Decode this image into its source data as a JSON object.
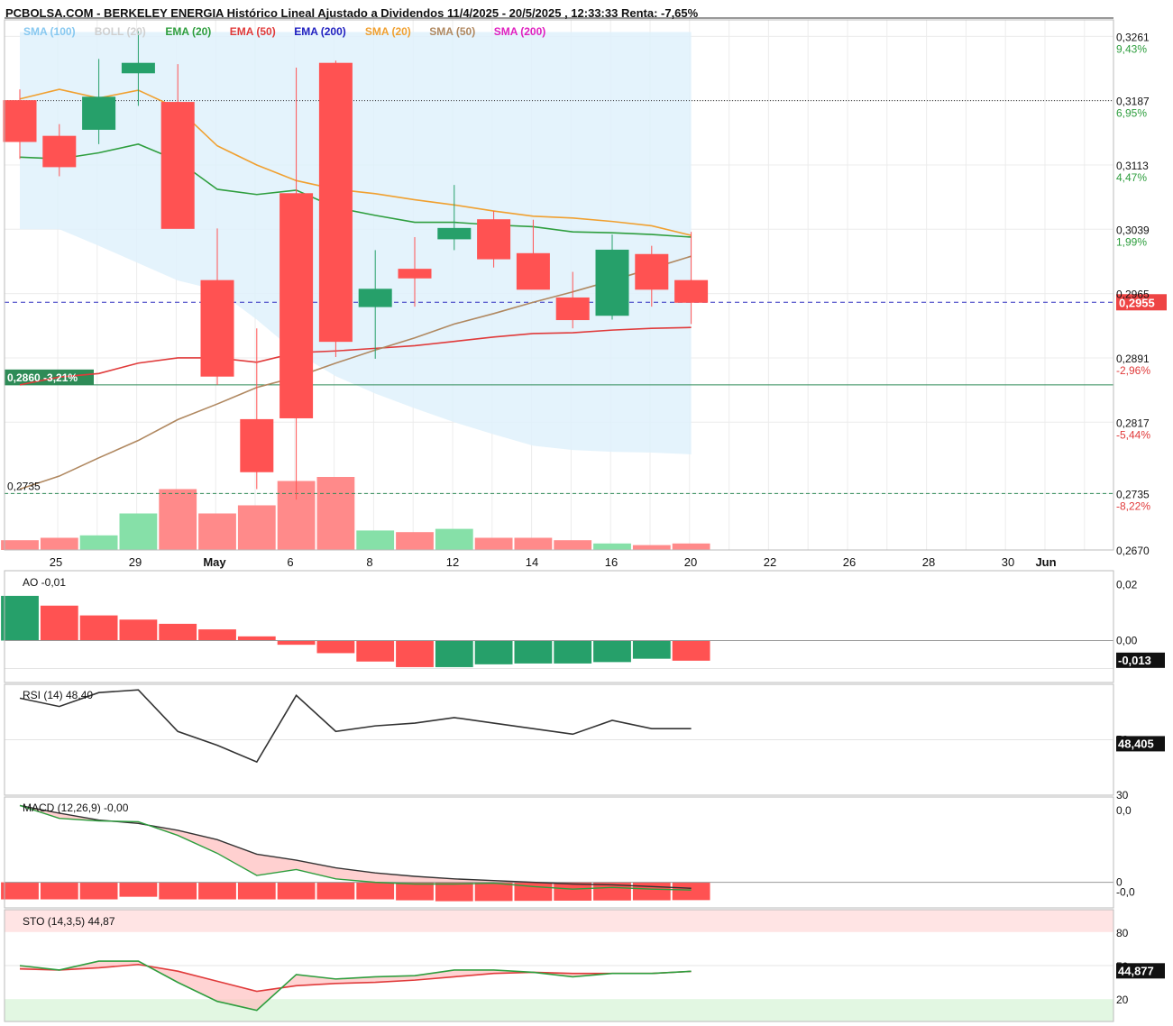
{
  "header": {
    "title": "PCBOLSA.COM - BERKELEY ENERGIA Histórico Lineal Ajustado a Dividendos 11/4/2025 - 20/5/2025 , 12:33:33 Renta: -7,65%"
  },
  "colors": {
    "up": "#26a06a",
    "down": "#ff5252",
    "sma100": "#87c8f0",
    "boll": "#c8c8c8",
    "ema20": "#2e9e3e",
    "ema50": "#e03a3a",
    "ema200": "#2020c0",
    "sma20": "#f0a030",
    "sma50": "#b08860",
    "sma200": "#e020c0",
    "band_fill": "#dff1fb",
    "last_price": "#ee4444",
    "ref_line": "#2e8b57"
  },
  "legend": [
    {
      "label": "SMA (100)",
      "color": "#87c8f0"
    },
    {
      "label": "BOLL (20)",
      "color": "#d0d0d0"
    },
    {
      "label": "EMA (20)",
      "color": "#2e9e3e"
    },
    {
      "label": "EMA (50)",
      "color": "#e03a3a"
    },
    {
      "label": "EMA (200)",
      "color": "#2020c0"
    },
    {
      "label": "SMA (20)",
      "color": "#f0a030"
    },
    {
      "label": "SMA (50)",
      "color": "#b08860"
    },
    {
      "label": "SMA (200)",
      "color": "#e020c0"
    }
  ],
  "price_axis": [
    {
      "value": "0,3261",
      "pct": "9,43%",
      "pct_color": "#2e9e3e"
    },
    {
      "value": "0,3187",
      "pct": "6,95%",
      "pct_color": "#2e9e3e"
    },
    {
      "value": "0,3113",
      "pct": "4,47%",
      "pct_color": "#2e9e3e"
    },
    {
      "value": "0,3039",
      "pct": "1,99%",
      "pct_color": "#2e9e3e"
    },
    {
      "value": "0,2965",
      "pct": "",
      "pct_color": "#2e9e3e"
    },
    {
      "value": "0,2891",
      "pct": "-2,96%",
      "pct_color": "#e03a3a"
    },
    {
      "value": "0,2817",
      "pct": "-5,44%",
      "pct_color": "#e03a3a"
    },
    {
      "value": "0,2735",
      "pct": "-8,22%",
      "pct_color": "#e03a3a"
    },
    {
      "value": "0,2670",
      "pct": "",
      "pct_color": "#e03a3a"
    }
  ],
  "last_price_label": "0,2955",
  "ref_label": "0,2860 -3,21%",
  "low_label": "0,2735",
  "x_ticks": [
    {
      "label": "25",
      "bold": false
    },
    {
      "label": "29",
      "bold": false
    },
    {
      "label": "May",
      "bold": true
    },
    {
      "label": "6",
      "bold": false
    },
    {
      "label": "8",
      "bold": false
    },
    {
      "label": "12",
      "bold": false
    },
    {
      "label": "14",
      "bold": false
    },
    {
      "label": "16",
      "bold": false
    },
    {
      "label": "20",
      "bold": false
    },
    {
      "label": "22",
      "bold": false
    },
    {
      "label": "26",
      "bold": false
    },
    {
      "label": "28",
      "bold": false
    },
    {
      "label": "30",
      "bold": false
    },
    {
      "label": "Jun",
      "bold": true
    }
  ],
  "chart_data": [
    {
      "type": "candlestick",
      "title": "PCBOLSA.COM - BERKELEY ENERGIA Histórico Lineal Ajustado a Dividendos 11/4/2025 - 20/5/2025 , 12:33:33 Renta: -7,65%",
      "ylim": [
        0.267,
        0.328
      ],
      "candles": [
        {
          "open": 0.3187,
          "high": 0.32,
          "low": 0.312,
          "close": 0.314
        },
        {
          "open": 0.3146,
          "high": 0.316,
          "low": 0.31,
          "close": 0.3111
        },
        {
          "open": 0.3154,
          "high": 0.3235,
          "low": 0.3137,
          "close": 0.3191
        },
        {
          "open": 0.3219,
          "high": 0.3267,
          "low": 0.3181,
          "close": 0.323
        },
        {
          "open": 0.3185,
          "high": 0.3229,
          "low": 0.3044,
          "close": 0.304
        },
        {
          "open": 0.298,
          "high": 0.304,
          "low": 0.286,
          "close": 0.287
        },
        {
          "open": 0.282,
          "high": 0.2925,
          "low": 0.274,
          "close": 0.276
        },
        {
          "open": 0.308,
          "high": 0.3225,
          "low": 0.2728,
          "close": 0.2822
        },
        {
          "open": 0.323,
          "high": 0.3233,
          "low": 0.2892,
          "close": 0.291
        },
        {
          "open": 0.295,
          "high": 0.3015,
          "low": 0.289,
          "close": 0.297
        },
        {
          "open": 0.2993,
          "high": 0.303,
          "low": 0.295,
          "close": 0.2983
        },
        {
          "open": 0.3028,
          "high": 0.309,
          "low": 0.3015,
          "close": 0.304
        },
        {
          "open": 0.305,
          "high": 0.306,
          "low": 0.2995,
          "close": 0.3005
        },
        {
          "open": 0.3011,
          "high": 0.305,
          "low": 0.297,
          "close": 0.297
        },
        {
          "open": 0.296,
          "high": 0.299,
          "low": 0.2925,
          "close": 0.2935
        },
        {
          "open": 0.294,
          "high": 0.3033,
          "low": 0.2935,
          "close": 0.3015
        },
        {
          "open": 0.301,
          "high": 0.302,
          "low": 0.295,
          "close": 0.297
        },
        {
          "open": 0.298,
          "high": 0.3036,
          "low": 0.293,
          "close": 0.2955
        }
      ],
      "series": [
        {
          "name": "SMA (20)",
          "values": [
            0.3189,
            0.32,
            0.319,
            0.3199,
            0.3178,
            0.3135,
            0.3113,
            0.3095,
            0.3085,
            0.308,
            0.3073,
            0.3067,
            0.306,
            0.3054,
            0.3052,
            0.3048,
            0.3043,
            0.3032
          ]
        },
        {
          "name": "EMA (20)",
          "values": [
            0.3122,
            0.312,
            0.3127,
            0.3137,
            0.3118,
            0.3085,
            0.3079,
            0.3084,
            0.3064,
            0.3055,
            0.3047,
            0.3047,
            0.3044,
            0.3042,
            0.3036,
            0.3035,
            0.3033,
            0.303
          ]
        },
        {
          "name": "EMA (50)",
          "values": [
            0.286,
            0.2869,
            0.2873,
            0.2885,
            0.2891,
            0.2891,
            0.2886,
            0.2897,
            0.2899,
            0.2902,
            0.2905,
            0.291,
            0.2915,
            0.2919,
            0.292,
            0.2923,
            0.2925,
            0.2926
          ]
        },
        {
          "name": "SMA (50)",
          "values": [
            0.274,
            0.2755,
            0.2776,
            0.2796,
            0.282,
            0.2838,
            0.2857,
            0.2869,
            0.2885,
            0.29,
            0.2914,
            0.293,
            0.2942,
            0.2955,
            0.2967,
            0.298,
            0.2994,
            0.3008
          ]
        }
      ],
      "bollinger": {
        "upper": [
          0.3266,
          0.3266,
          0.3266,
          0.3266,
          0.3266,
          0.3266,
          0.3266,
          0.3266,
          0.3266,
          0.3266,
          0.3266,
          0.3266,
          0.3266,
          0.3266,
          0.3266,
          0.3266,
          0.3266,
          0.3266
        ],
        "lower": [
          0.3039,
          0.3039,
          0.302,
          0.3,
          0.298,
          0.2969,
          0.2935,
          0.2897,
          0.287,
          0.285,
          0.2833,
          0.2817,
          0.2803,
          0.279,
          0.2785,
          0.2783,
          0.2782,
          0.278
        ]
      },
      "volume": [
        12,
        15,
        18,
        45,
        75,
        45,
        55,
        85,
        90,
        24,
        22,
        26,
        15,
        15,
        12,
        8,
        6,
        8
      ],
      "last_price": 0.2955,
      "reference": 0.286,
      "low_line": 0.2735,
      "upper_line": 0.3187
    },
    {
      "type": "bar",
      "name": "AO",
      "title": "AO -0,01",
      "ylim": [
        -0.015,
        0.025
      ],
      "values": [
        0.016,
        0.0125,
        0.009,
        0.0075,
        0.006,
        0.004,
        0.0015,
        -0.0015,
        -0.0045,
        -0.0075,
        -0.0095,
        -0.0095,
        -0.0085,
        -0.0082,
        -0.0082,
        -0.0077,
        -0.0065,
        -0.0072
      ],
      "colors": [
        "up",
        "down",
        "down",
        "down",
        "down",
        "down",
        "down",
        "down",
        "down",
        "down",
        "down",
        "up",
        "up",
        "up",
        "up",
        "up",
        "up",
        "down"
      ],
      "last_value": "-0,013",
      "axis": [
        "0,02",
        "0,00"
      ]
    },
    {
      "type": "line",
      "name": "RSI (14)",
      "title": "RSI (14) 48,40",
      "ylim": [
        30,
        70
      ],
      "values": [
        65,
        62,
        67,
        68,
        53,
        48,
        42,
        66,
        53,
        55,
        56,
        58,
        56,
        54,
        52,
        57,
        54,
        54
      ],
      "last_value": "48,405",
      "axis": [
        "50",
        "30"
      ]
    },
    {
      "type": "line",
      "name": "MACD (12,26,9)",
      "title": "MACD (12,26,9) -0,00",
      "ylim": [
        -0.012,
        0.001
      ],
      "macd": [
        0.0,
        -0.0015,
        -0.0018,
        -0.0019,
        -0.0035,
        -0.0056,
        -0.0082,
        -0.0075,
        -0.0086,
        -0.009,
        -0.0092,
        -0.0092,
        -0.0091,
        -0.0095,
        -0.0098,
        -0.0096,
        -0.0098,
        -0.0099
      ],
      "signal": [
        0.0,
        -0.0009,
        -0.0017,
        -0.0021,
        -0.0029,
        -0.004,
        -0.0057,
        -0.0064,
        -0.0073,
        -0.0079,
        -0.0083,
        -0.0086,
        -0.0088,
        -0.009,
        -0.0092,
        -0.0093,
        -0.0095,
        -0.0097
      ],
      "histogram": [
        -0.0092,
        -0.0092,
        -0.0092,
        -0.0078,
        -0.0092,
        -0.0092,
        -0.0092,
        -0.0092,
        -0.0092,
        -0.0092,
        -0.0097,
        -0.0102,
        -0.0101,
        -0.01,
        -0.0099,
        -0.0098,
        -0.0097,
        -0.0096
      ],
      "axis": [
        "0,0",
        "0",
        "-0,0"
      ]
    },
    {
      "type": "line",
      "name": "STO (14,3,5)",
      "title": "STO (14,3,5) 44,87",
      "ylim": [
        0,
        100
      ],
      "k": [
        50,
        46,
        54,
        54,
        35,
        18,
        10,
        42,
        38,
        40,
        41,
        46,
        46,
        44,
        40,
        43,
        43,
        44.9
      ],
      "d": [
        47,
        46,
        48,
        51,
        45,
        36,
        27,
        32,
        34,
        35,
        37,
        40,
        43,
        44,
        43,
        43,
        43,
        44.8
      ],
      "last_value": "44,877",
      "axis": [
        "80",
        "50",
        "20"
      ]
    }
  ]
}
